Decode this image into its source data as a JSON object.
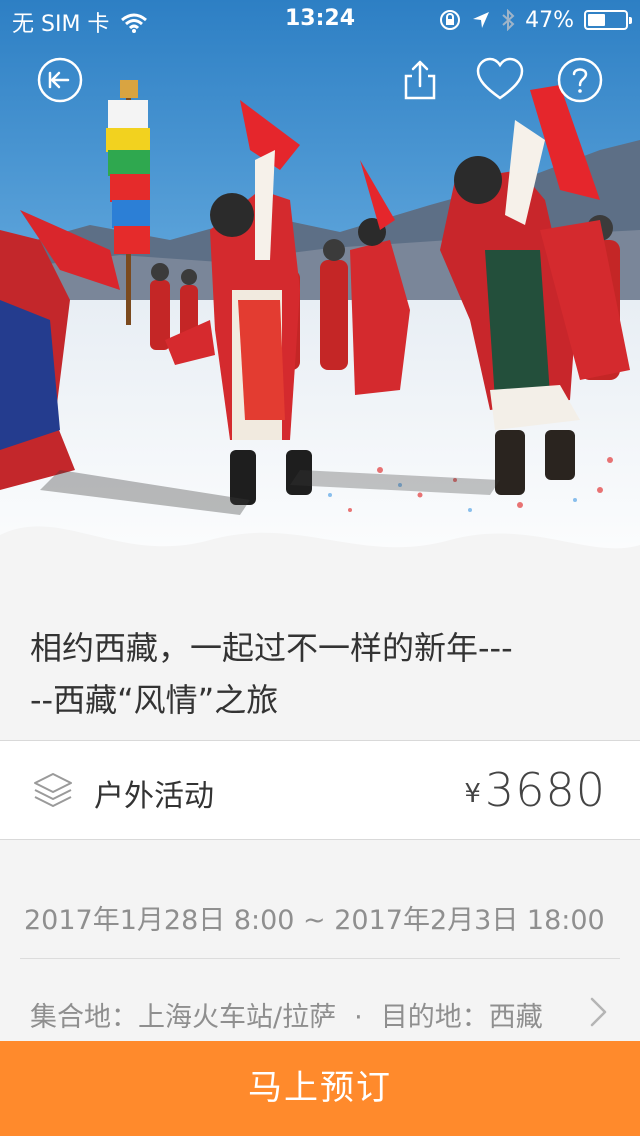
{
  "status_bar": {
    "carrier": "无 SIM 卡",
    "time": "13:24",
    "battery": "47%",
    "battery_level": 0.47
  },
  "nav": {
    "back_icon": "back-arrow-circle-icon",
    "share_icon": "share-icon",
    "favorite_icon": "heart-icon",
    "help_icon": "question-circle-icon"
  },
  "event": {
    "title": "相约西藏，一起过不一样的新年-----西藏“风情”之旅",
    "category_icon": "layers-icon",
    "category": "户外活动",
    "currency": "¥",
    "price": "3680",
    "date_range": "2017年1月28日 8:00 ~ 2017年2月3日 18:00",
    "meeting_place": "集合地：上海火车站/拉萨",
    "separator": "·",
    "destination": "目的地：西藏"
  },
  "actions": {
    "book_label": "马上预订"
  },
  "colors": {
    "accent": "#ff8a2c",
    "text_primary": "#333333",
    "text_secondary": "#8f8f8f",
    "background": "#f4f4f4"
  }
}
